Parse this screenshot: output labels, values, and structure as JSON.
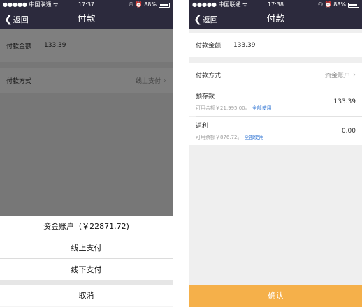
{
  "left": {
    "status": {
      "carrier": "●●●●● 中国联通 ᯤ",
      "time": "17:37",
      "icons": "⚇ ⏰ 88%"
    },
    "nav": {
      "back": "返回",
      "title": "付款"
    },
    "amount": {
      "label": "付款金额",
      "value": "133.39"
    },
    "method": {
      "label": "付款方式",
      "value": "线上支付"
    },
    "sheet": {
      "options": [
        "资金账户（￥22871.72)",
        "线上支付",
        "线下支付"
      ],
      "cancel": "取消"
    }
  },
  "right": {
    "status": {
      "carrier": "●●●●● 中国联通 ᯤ",
      "time": "17:38",
      "icons": "⚇ ⏰ 88%"
    },
    "nav": {
      "back": "返回",
      "title": "付款"
    },
    "amount": {
      "label": "付款金额",
      "value": "133.39"
    },
    "method": {
      "label": "付款方式",
      "value": "资金账户"
    },
    "deposit": {
      "label": "预存款",
      "available": "可用余额￥21,995.00。",
      "use_all": "全部使用",
      "value": "133.39"
    },
    "rebate": {
      "label": "返利",
      "available": "可用余额￥876.72。",
      "use_all": "全部使用",
      "value": "0.00"
    },
    "confirm": "确认"
  }
}
